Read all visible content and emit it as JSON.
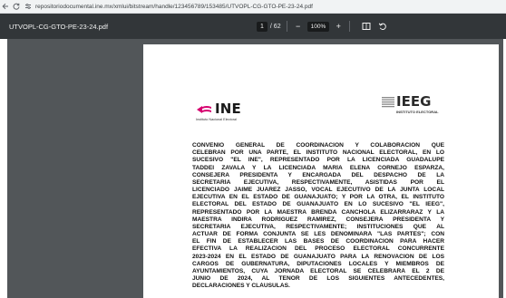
{
  "browser": {
    "url": "repositoriodocumental.ine.mx/xmlui/bitstream/handle/123456789/153485/UTVOPL-CG-GTO-PE-23-24.pdf",
    "back_icon": "arrow-left-icon",
    "forward_icon": "arrow-right-icon",
    "reload_icon": "reload-icon",
    "site_info_icon": "tune-icon"
  },
  "pdf_toolbar": {
    "title": "UTVOPL-CG-GTO-PE-23-24.pdf",
    "current_page": "1",
    "page_total": "/ 62",
    "zoom_out": "−",
    "zoom": "100%",
    "zoom_in": "+"
  },
  "logos": {
    "ine_text": "INE",
    "ine_sub": "Instituto Nacional Electoral",
    "ieeg_text": "IEEG",
    "ieeg_sub": "INSTITUTO ELECTORAL",
    "ine_color": "#d6006f",
    "ieeg_color": "#6b6b6b"
  },
  "document": {
    "lines": [
      "CONVENIO GENERAL DE COORDINACIÓN Y COLABORACIÓN QUE",
      "CELEBRAN POR UNA PARTE, EL INSTITUTO NACIONAL ELECTORAL, EN LO",
      "SUCESIVO \"EL INE\", REPRESENTADO POR LA LICENCIADA GUADALUPE",
      "TADDEI ZAVALA Y LA LICENCIADA MARÍA ELENA CORNEJO ESPARZA,",
      "CONSEJERA PRESIDENTA Y ENCARGADA DEL DESPACHO DE LA",
      "SECRETARÍA EJECUTIVA, RESPECTIVAMENTE, ASISTIDAS POR EL",
      "LICENCIADO JAIME JUÁREZ JASSO, VOCAL EJECUTIVO DE LA JUNTA LOCAL",
      "EJECUTIVA EN EL ESTADO DE GUANAJUATO; Y POR LA OTRA, EL INSTITUTO",
      "ELECTORAL DEL ESTADO DE GUANAJUATO EN LO SUCESIVO \"EL IEEG\",",
      "REPRESENTADO POR LA MAESTRA BRENDA CANCHOLA ELIZARRARAZ Y LA",
      "MAESTRA INDIRA RODRÍGUEZ RAMÍREZ, CONSEJERA PRESIDENTA Y",
      "SECRETARIA EJECUTIVA, RESPECTIVAMENTE; INSTITUCIONES QUE AL",
      "ACTUAR DE FORMA CONJUNTA SE LES DENOMINARÁ \"LAS PARTES\"; CON",
      "EL FIN DE ESTABLECER LAS BASES DE COORDINACIÓN PARA HACER",
      "EFECTIVA LA REALIZACIÓN DEL PROCESO ELECTORAL CONCURRENTE",
      "2023-2024 EN EL ESTADO DE GUANAJUATO PARA LA RENOVACIÓN DE LOS",
      "CARGOS DE GUBERNATURA, DIPUTACIONES LOCALES Y MIEMBROS DE",
      "AYUNTAMIENTOS, CUYA JORNADA ELECTORAL SE CELEBRARÁ EL 2 DE",
      "JUNIO DE 2024, AL TENOR DE LOS SIGUIENTES ANTECEDENTES,",
      "DECLARACIONES Y CLÁUSULAS."
    ]
  }
}
